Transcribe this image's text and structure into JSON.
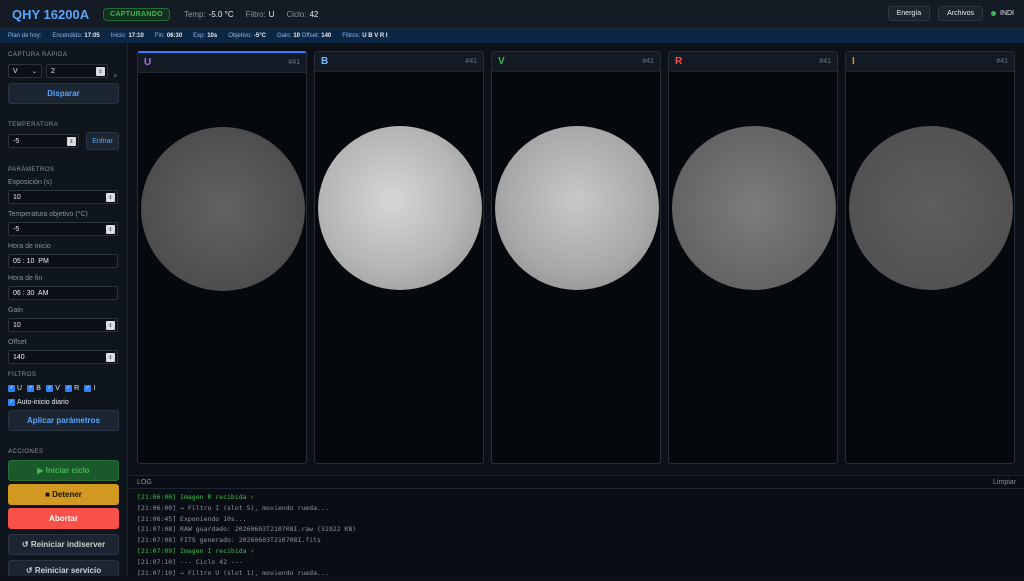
{
  "header": {
    "app_name": "QHY 16200A",
    "status": "CAPTURANDO",
    "temp_label": "Temp:",
    "temp_value": "-5.0 °C",
    "filter_label": "Filtro:",
    "filter_value": "U",
    "cycle_label": "Ciclo:",
    "cycle_value": "42",
    "energy_button": "Energía",
    "files_button": "Archivos",
    "indi_label": "INDI",
    "indi_color": "#3fb950"
  },
  "plan": {
    "title": "Plan de hoy:",
    "items": [
      {
        "label": "Encendido:",
        "value": "17:05"
      },
      {
        "label": "Inicio:",
        "value": "17:10"
      },
      {
        "label": "Fin:",
        "value": "06:30"
      },
      {
        "label": "Exp:",
        "value": "10s"
      },
      {
        "label": "Objetivo:",
        "value": "-5°C"
      },
      {
        "label": "Gain:",
        "value": "10"
      },
      {
        "label": "Offset:",
        "value": "140"
      },
      {
        "label": "Filtros:",
        "value": "U B V R I"
      }
    ]
  },
  "sidebar": {
    "quick_capture": {
      "title": "CAPTURA RÁPIDA",
      "filter_select": "V",
      "count": "2",
      "unit": "s",
      "shoot_button": "Disparar"
    },
    "temperature": {
      "title": "TEMPERATURA",
      "value": "-5",
      "cool_button": "Enfriar"
    },
    "params": {
      "title": "PARÁMETROS",
      "exposure_label": "Exposición (s)",
      "exposure": "10",
      "target_temp_label": "Temperatura objetivo (°C)",
      "target_temp": "-5",
      "start_label": "Hora de inicio",
      "start": "05 : 10  PM",
      "end_label": "Hora de fin",
      "end": "06 : 30  AM",
      "gain_label": "Gain",
      "gain": "10",
      "offset_label": "Offset",
      "offset": "140"
    },
    "filters": {
      "title": "FILTROS",
      "items": [
        "U",
        "B",
        "V",
        "R",
        "I"
      ],
      "auto_start": "Auto-inicio diario",
      "apply_button": "Aplicar parámetros"
    },
    "actions": {
      "title": "ACCIONES",
      "start": "▶ Iniciar ciclo",
      "stop": "■ Detener",
      "abort": "Abortar",
      "restart_indi": "↺ Reiniciar indiserver",
      "restart_service": "↺ Reiniciar servicio"
    }
  },
  "panels": [
    {
      "name": "U",
      "num": "#41",
      "color": "#58a6ff"
    },
    {
      "name": "B",
      "num": "#41",
      "color": "#79b8ff"
    },
    {
      "name": "V",
      "num": "#41",
      "color": "#3fb950"
    },
    {
      "name": "R",
      "num": "#41",
      "color": "#f85149"
    },
    {
      "name": "I",
      "num": "#41",
      "color": "#d29922"
    }
  ],
  "log": {
    "title": "LOG",
    "clear_button": "Limpiar",
    "lines": [
      {
        "text": "[21:06:00] Imagen R recibida ✓",
        "ok": true
      },
      {
        "text": "[21:06:00] → Filtro I (slot 5), moviendo rueda...",
        "ok": false
      },
      {
        "text": "[21:06:45] Exponiendo 10s...",
        "ok": false
      },
      {
        "text": "[21:07:08] RAW guardado: 20260603T210708I.raw (31922 KB)",
        "ok": false
      },
      {
        "text": "[21:07:08] FITS generado: 20260603T210708I.fits",
        "ok": false
      },
      {
        "text": "[21:07:09] Imagen I recibida ✓",
        "ok": true
      },
      {
        "text": "[21:07:10] --- Ciclo 42 ---",
        "ok": false
      },
      {
        "text": "[21:07:10] → Filtro U (slot 1), moviendo rueda...",
        "ok": false
      }
    ]
  }
}
